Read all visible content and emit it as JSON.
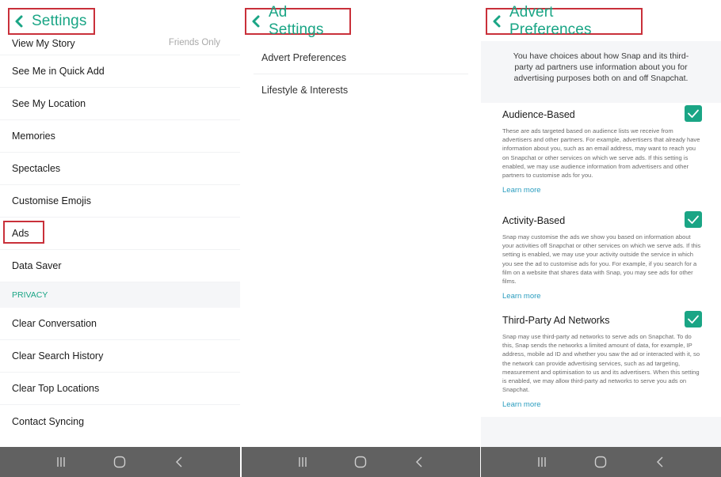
{
  "accent_color": "#1aa585",
  "highlight_color": "#c9303a",
  "link_color": "#2a9dbf",
  "panels": {
    "settings": {
      "title": "Settings",
      "back_icon": "chevron-left-icon",
      "items": [
        {
          "label": "View My Story",
          "value": "Friends Only"
        },
        {
          "label": "See Me in Quick Add"
        },
        {
          "label": "See My Location"
        },
        {
          "label": "Memories"
        },
        {
          "label": "Spectacles"
        },
        {
          "label": "Customise Emojis"
        },
        {
          "label": "Ads",
          "highlighted": true
        },
        {
          "label": "Data Saver"
        }
      ],
      "section_header": "PRIVACY",
      "privacy_items": [
        {
          "label": "Clear Conversation"
        },
        {
          "label": "Clear Search History"
        },
        {
          "label": "Clear Top Locations"
        },
        {
          "label": "Contact Syncing"
        }
      ]
    },
    "ad_settings": {
      "title": "Ad Settings",
      "back_icon": "chevron-left-icon",
      "items": [
        {
          "label": "Advert Preferences"
        },
        {
          "label": "Lifestyle & Interests"
        }
      ]
    },
    "advert_preferences": {
      "title": "Advert Preferences",
      "back_icon": "chevron-left-icon",
      "intro": "You have choices about how Snap and its third-party ad partners use information about you for advertising purposes both on and off Snapchat.",
      "sections": [
        {
          "title": "Audience-Based",
          "checked": true,
          "description": "These are ads targeted based on audience lists we receive from advertisers and other partners. For example, advertisers that already have information about you, such as an email address, may want to reach you on Snapchat or other services on which we serve ads. If this setting is enabled, we may use audience information from advertisers and other partners to customise ads for you.",
          "link": "Learn more"
        },
        {
          "title": "Activity-Based",
          "checked": true,
          "description": "Snap may customise the ads we show you based on information about your activities off Snapchat or other services on which we serve ads. If this setting is enabled, we may use your activity outside the service in which you see the ad to customise ads for you. For example, if you search for a film on a website that shares data with Snap, you may see ads for other films.",
          "link": "Learn more"
        },
        {
          "title": "Third-Party Ad Networks",
          "checked": true,
          "description": "Snap may use third-party ad networks to serve ads on Snapchat. To do this, Snap sends the networks a limited amount of data, for example, IP address, mobile ad ID and whether you saw the ad or interacted with it, so the network can provide advertising services, such as ad targeting, measurement and optimisation to us and its advertisers. When this setting is enabled, we may allow third-party ad networks to serve you ads on Snapchat.",
          "link": "Learn more"
        }
      ]
    }
  },
  "navbar": {
    "buttons": [
      "recent-apps-icon",
      "home-icon",
      "back-icon"
    ]
  }
}
